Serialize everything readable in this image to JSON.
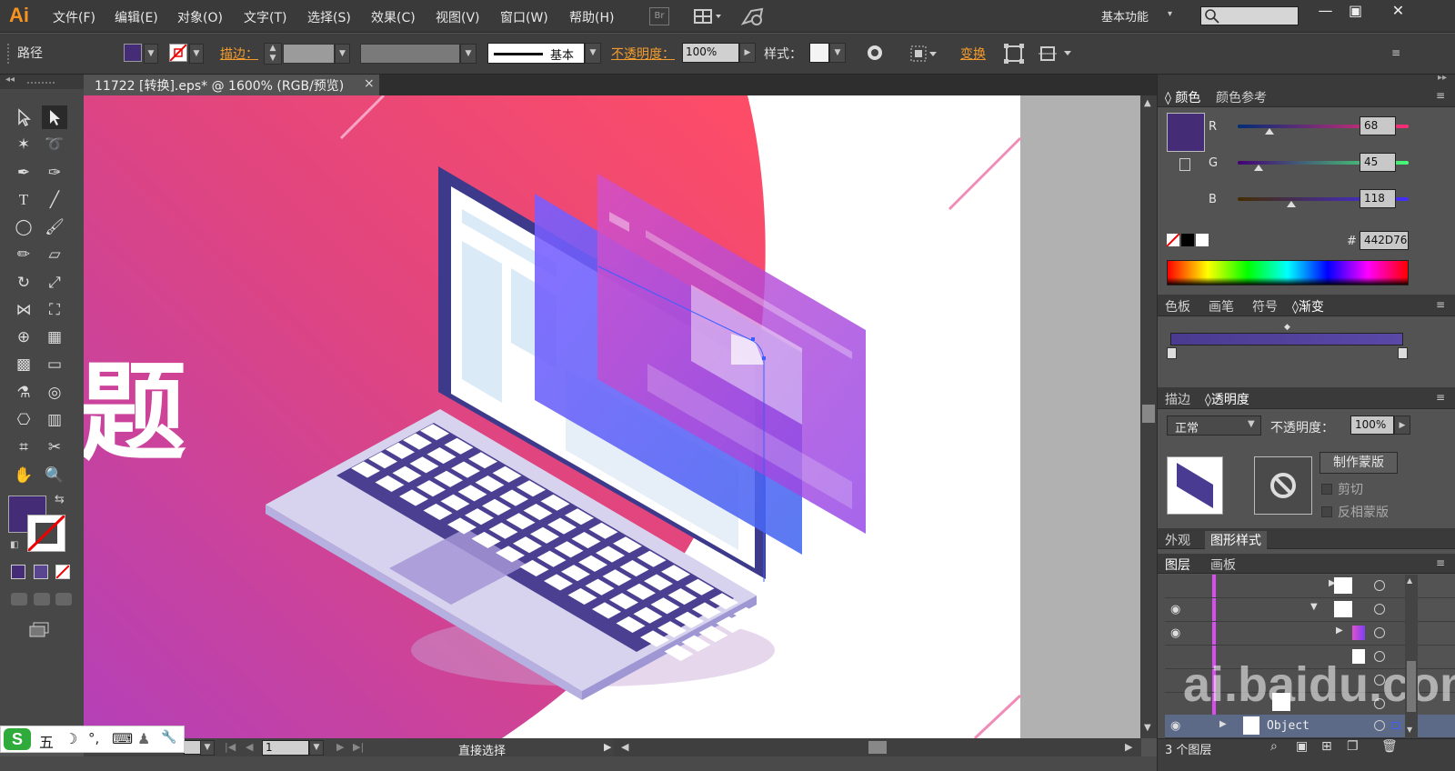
{
  "app": {
    "logo": "Ai",
    "menus": [
      "文件(F)",
      "编辑(E)",
      "对象(O)",
      "文字(T)",
      "选择(S)",
      "效果(C)",
      "视图(V)",
      "窗口(W)",
      "帮助(H)"
    ],
    "bridge_label": "Br",
    "workspace": "基本功能",
    "window_buttons": [
      "—",
      "▣",
      "✕"
    ]
  },
  "control_bar": {
    "object_type": "路径",
    "stroke_label": "描边：",
    "stroke_profile": "基本",
    "opacity_label": "不透明度：",
    "opacity_value": "100%",
    "style_label": "样式：",
    "transform_label": "变换",
    "fill_color": "#442D76"
  },
  "document": {
    "tab_title": "11722 [转换].eps* @ 1600% (RGB/预览)",
    "tab_close": "×",
    "artwork_text": "题",
    "status_tool": "直接选择",
    "page_number": "1"
  },
  "color_panel": {
    "tabs": [
      "颜色",
      "颜色参考"
    ],
    "r_label": "R",
    "r_value": 68,
    "g_label": "G",
    "g_value": 45,
    "b_label": "B",
    "b_value": 118,
    "hex_label": "#",
    "hex_value": "442D76",
    "swatch_color": "#442D76"
  },
  "gradient_panel": {
    "tabs": [
      "色板",
      "画笔",
      "符号",
      "渐变"
    ]
  },
  "transparency_panel": {
    "tabs": [
      "描边",
      "透明度"
    ],
    "blend_mode": "正常",
    "opacity_label": "不透明度：",
    "opacity_value": "100%",
    "make_mask_button": "制作蒙版",
    "clip_label": "剪切",
    "invert_label": "反相蒙版"
  },
  "appearance_panel": {
    "tabs": [
      "外观",
      "图形样式"
    ]
  },
  "layers_panel": {
    "tabs": [
      "图层",
      "画板"
    ],
    "object_row_name": "Object",
    "layer_count": "3 个图层"
  },
  "watermark": "ai.baidu.com",
  "ime": {
    "logo": "S",
    "mode": "五",
    "moon": "☽",
    "punct": "°,",
    "keyboard": "⌨",
    "person": "♟",
    "tool": "🔧"
  },
  "colors": {
    "accent_orange": "#f39c2d",
    "panel_bg": "#535353",
    "menubar_bg": "#3a3a3a"
  }
}
